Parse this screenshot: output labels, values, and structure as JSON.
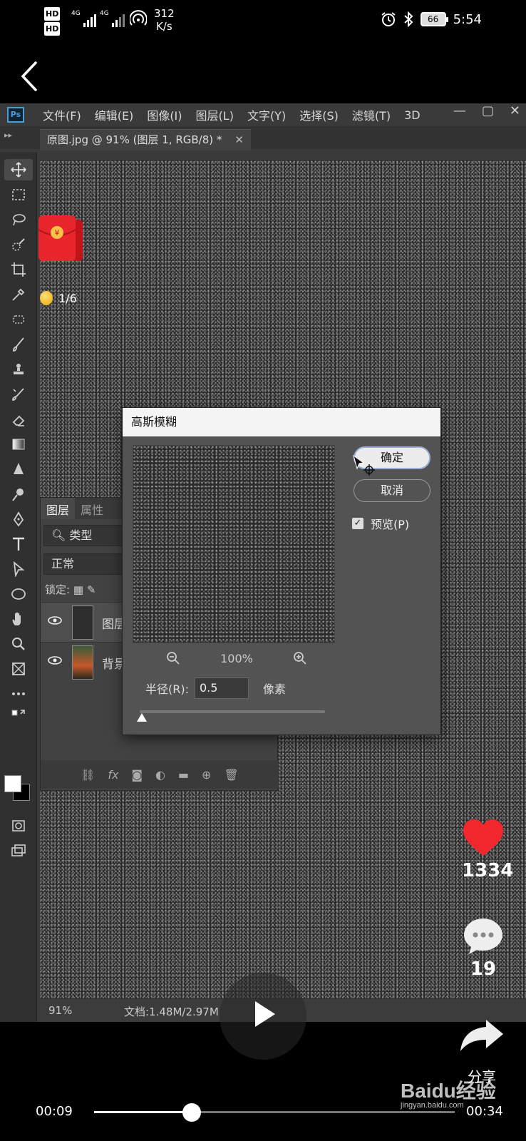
{
  "status_bar": {
    "hd1": "HD",
    "hd2": "HD",
    "sig1_label": "4G",
    "sig2_label": "4G",
    "speed_value": "312",
    "speed_unit": "K/s",
    "battery": "66",
    "time": "5:54"
  },
  "photoshop": {
    "menu": [
      "文件(F)",
      "编辑(E)",
      "图像(I)",
      "图层(L)",
      "文字(Y)",
      "选择(S)",
      "滤镜(T)",
      "3D"
    ],
    "logo": "Ps",
    "doc_tab": "原图.jpg @ 91% (图层 1, RGB/8) *",
    "status_zoom": "91%",
    "status_doc": "文档:1.48M/2.97M",
    "layers_panel": {
      "tab_layers": "图层",
      "tab_properties": "属性",
      "filter_type": "类型",
      "blend_mode": "正常",
      "lock_label": "锁定:",
      "layers": [
        {
          "name": "图层",
          "selected": true
        },
        {
          "name": "背景",
          "selected": false
        }
      ],
      "bottom_fx": "fx"
    },
    "dialog": {
      "title": "高斯模糊",
      "ok": "确定",
      "cancel": "取消",
      "preview_label": "预览(P)",
      "preview_checked": true,
      "zoom": "100%",
      "radius_label": "半径(R):",
      "radius_value": "0.5",
      "radius_unit": "像素"
    }
  },
  "overlay": {
    "coin_progress": "1/6",
    "likes": "1334",
    "comments": "19",
    "share": "分享",
    "current_time": "00:09",
    "total_time": "00:34",
    "progress_fraction": 0.27,
    "watermark": "Baidu经验",
    "watermark_sub": "jingyan.baidu.com"
  }
}
